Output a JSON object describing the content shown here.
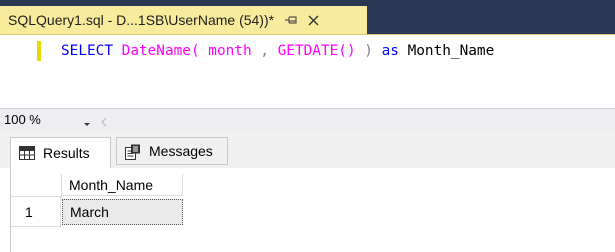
{
  "document_tab": {
    "title": "SQLQuery1.sql - D...1SB\\UserName (54))*",
    "pin_icon": "pin-icon",
    "close_icon": "close-icon"
  },
  "editor": {
    "tokens": [
      {
        "text": "SELECT",
        "role": "keyword"
      },
      {
        "text": " ",
        "role": "space"
      },
      {
        "text": "DateName(",
        "role": "function"
      },
      {
        "text": " month ",
        "role": "function"
      },
      {
        "text": ",",
        "role": "operator"
      },
      {
        "text": " GETDATE()",
        "role": "function"
      },
      {
        "text": " ) ",
        "role": "operator"
      },
      {
        "text": "as",
        "role": "keyword"
      },
      {
        "text": " Month_Name",
        "role": "identifier"
      }
    ],
    "colors": {
      "keyword": "#0000ff",
      "function": "#ff00ff",
      "operator": "#808080",
      "identifier": "#000000"
    }
  },
  "zoom": {
    "value": "100 %"
  },
  "results": {
    "tabs": [
      {
        "label": "Results",
        "icon": "grid-icon"
      },
      {
        "label": "Messages",
        "icon": "messages-icon"
      }
    ],
    "columns": [
      "Month_Name"
    ],
    "rows": [
      {
        "num": "1",
        "cells": [
          "March"
        ]
      }
    ]
  }
}
